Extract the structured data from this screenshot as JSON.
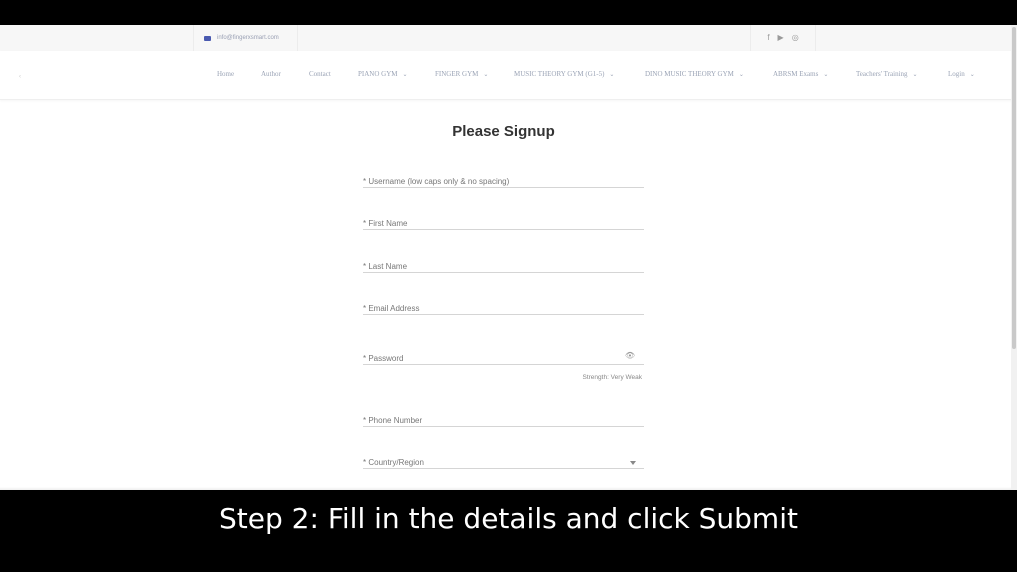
{
  "topbar": {
    "email": "info@fingerxsmart.com",
    "social_icons": [
      "facebook-icon",
      "youtube-icon",
      "instagram-icon"
    ]
  },
  "nav": {
    "items": [
      {
        "label": "Home",
        "dropdown": false
      },
      {
        "label": "Author",
        "dropdown": false
      },
      {
        "label": "Contact",
        "dropdown": false
      },
      {
        "label": "PIANO GYM",
        "dropdown": true
      },
      {
        "label": "FINGER GYM",
        "dropdown": true
      },
      {
        "label": "MUSIC THEORY GYM (G1-5)",
        "dropdown": true
      },
      {
        "label": "DINO MUSIC THEORY GYM",
        "dropdown": true
      },
      {
        "label": "ABRSM Exams",
        "dropdown": true
      },
      {
        "label": "Teachers' Training",
        "dropdown": true
      },
      {
        "label": "Login",
        "dropdown": true
      }
    ]
  },
  "form": {
    "title": "Please Signup",
    "fields": {
      "username": {
        "placeholder": "* Username (low caps only & no spacing)",
        "value": ""
      },
      "first_name": {
        "placeholder": "* First Name",
        "value": ""
      },
      "last_name": {
        "placeholder": "* Last Name",
        "value": ""
      },
      "email": {
        "placeholder": "* Email Address",
        "value": ""
      },
      "password": {
        "placeholder": "* Password",
        "value": ""
      },
      "phone": {
        "placeholder": "* Phone Number",
        "value": ""
      },
      "country": {
        "placeholder": "* Country/Region",
        "value": ""
      }
    },
    "password_strength": "Strength: Very Weak"
  },
  "caption": "Step 2: Fill in the details and click Submit",
  "colors": {
    "email_icon": "#4a5ab0",
    "nav_text": "#9aa3b5",
    "caption_bg": "#000000",
    "caption_text": "#ffffff"
  }
}
